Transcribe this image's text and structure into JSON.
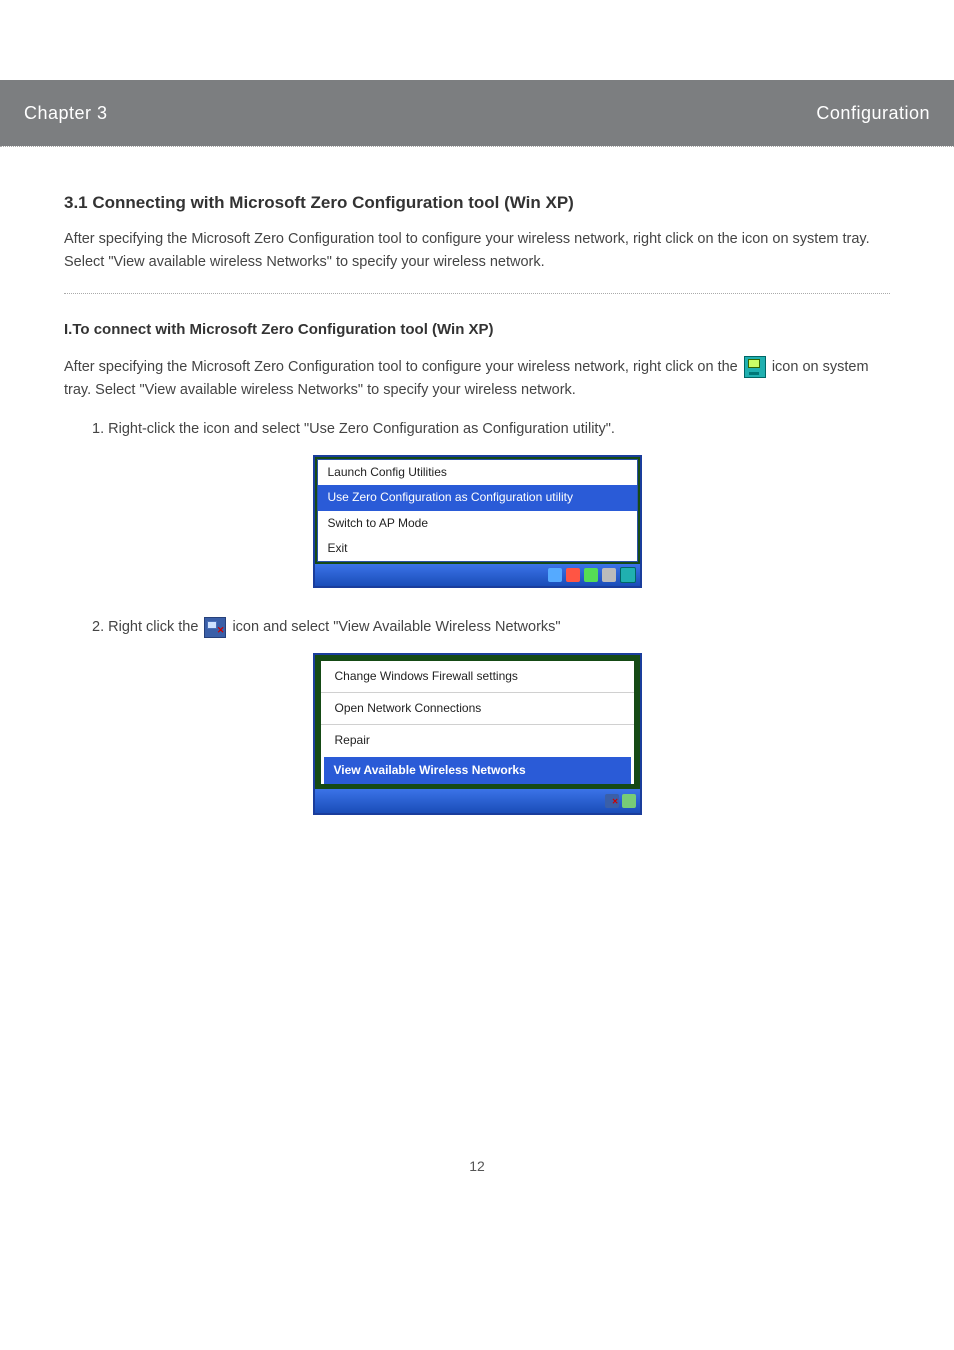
{
  "chapter_bar": {
    "left": "Chapter 3",
    "right": "Configuration"
  },
  "section_title": "3.1 Connecting with Microsoft Zero Configuration tool (Win XP)",
  "intro_para": "After specifying the Microsoft Zero Configuration tool to configure your wireless network, right click on the icon on system tray. Select \"View available wireless Networks\" to specify your wireless network.",
  "subsection_title": "I.To connect with Microsoft Zero Configuration tool (Win XP)",
  "para2": "After specifying the Microsoft Zero Configuration tool to configure your wireless network, right click on the",
  "para2_after": "icon on system tray. Select \"View available wireless Networks\" to specify your wireless network.",
  "step1_prefix": "1.",
  "step1_text": "Right-click the icon and select \"Use Zero Configuration as Configuration utility\".",
  "menu1": {
    "items": [
      "Launch Config Utilities",
      "Use Zero Configuration as Configuration utility",
      "Switch to AP Mode",
      "Exit"
    ],
    "highlight_index": 1
  },
  "step2_prefix": "2.",
  "step2_text_a": "Right click the",
  "step2_text_b": "icon and select \"View Available Wireless Networks\"",
  "menu2": {
    "items": [
      "Change Windows Firewall settings",
      "Open Network Connections",
      "Repair",
      "View Available Wireless Networks"
    ],
    "highlight_index": 3
  },
  "page_number": "12"
}
